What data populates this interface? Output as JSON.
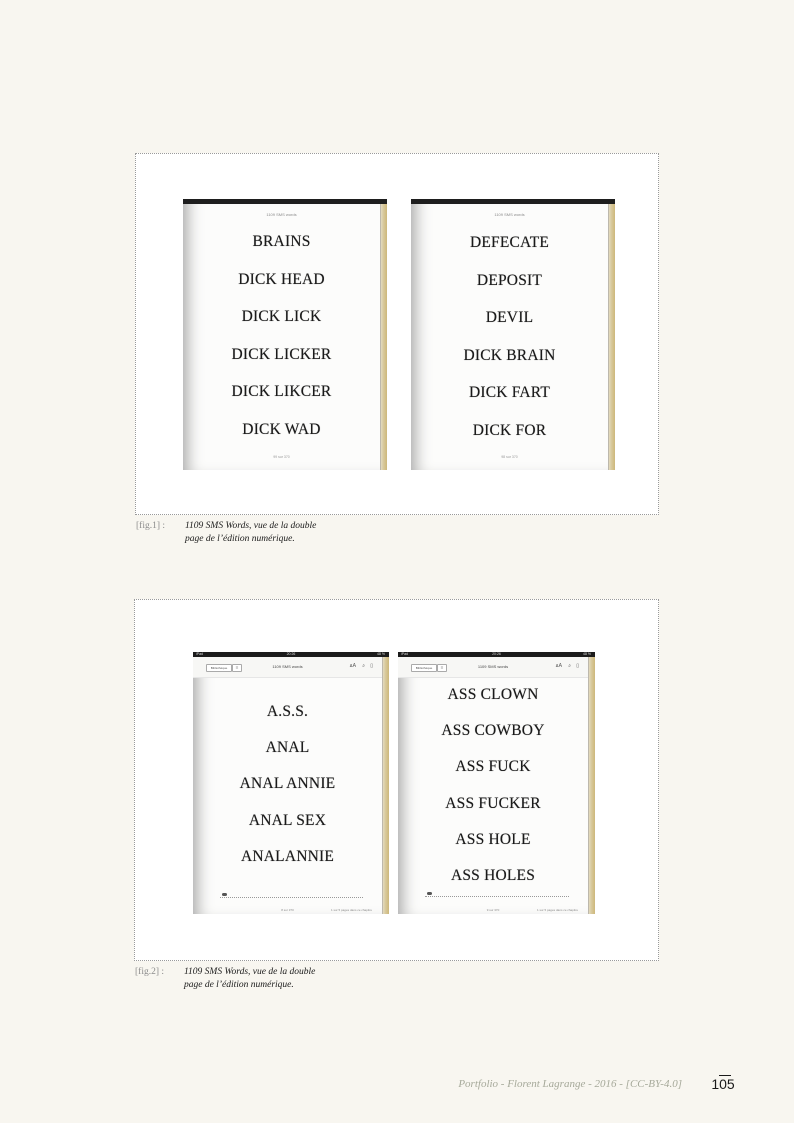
{
  "figure1": {
    "label": "[fig.1] :",
    "caption_line1": "1109 SMS Words, vue de la double",
    "caption_line2": "page de l’édition numérique.",
    "left_page": {
      "header": "1109 SMS words",
      "words": [
        "BRAINS",
        "DICK HEAD",
        "DICK LICK",
        "DICK LICKER",
        "DICK LIKCER",
        "DICK WAD"
      ],
      "footer": "99 sur 370"
    },
    "right_page": {
      "header": "1109 SMS words",
      "words": [
        "DEFECATE",
        "DEPOSIT",
        "DEVIL",
        "DICK BRAIN",
        "DICK FART",
        "DICK FOR"
      ],
      "footer": "98 sur 370"
    }
  },
  "figure2": {
    "label": "[fig.2] :",
    "caption_line1": "1109 SMS Words, vue de la double",
    "caption_line2": "page de l’édition numérique.",
    "status_left": "iPad",
    "status_time": "20:26",
    "status_right": "48 %",
    "toolbar_button": "Bibliothèque",
    "toolbar_title": "1109 SMS words",
    "left_page": {
      "words": [
        "A.S.S.",
        "ANAL",
        "ANAL ANNIE",
        "ANAL SEX",
        "ANALANNIE"
      ],
      "footer": "8 sur 370",
      "footer_right": "1 sur 5 pages dans ce chapitre"
    },
    "right_page": {
      "words": [
        "ASS CLOWN",
        "ASS COWBOY",
        "ASS FUCK",
        "ASS FUCKER",
        "ASS HOLE",
        "ASS HOLES"
      ],
      "footer": "9 sur 370",
      "footer_right": "1 sur 5 pages dans ce chapitre"
    }
  },
  "footer": {
    "text": "Portfolio - Florent Lagrange - 2016 - [CC-BY-4.0]",
    "page_number": "105"
  }
}
